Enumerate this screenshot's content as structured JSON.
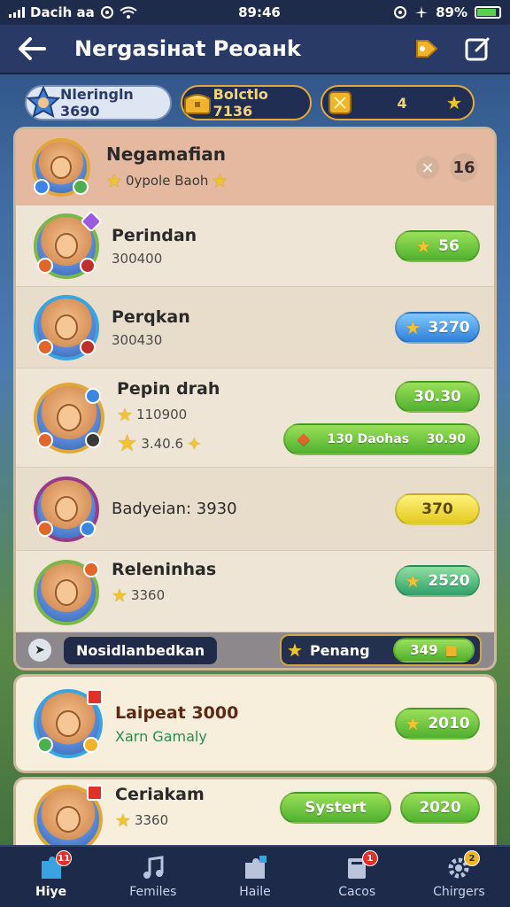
{
  "status_bar": {
    "carrier": "Dacih aa",
    "time": "89:46",
    "battery": "89%"
  },
  "header": {
    "title": "Nergasiнat Peoaнk"
  },
  "currency": [
    {
      "label": "Nleringln 3690"
    },
    {
      "label": "Bolctlo 7136"
    },
    {
      "label": "4"
    }
  ],
  "panel_head": {
    "name": "Negamafian",
    "sub": "0ypole Baoh",
    "count": "16"
  },
  "rows": [
    {
      "name": "Perindan",
      "value": "300400",
      "button": "56"
    },
    {
      "name": "Perqkan",
      "value": "300430",
      "button": "3270"
    },
    {
      "name": "Pepin drah",
      "value": "110900",
      "value2": "3.40.6",
      "button": "30.30",
      "sub_button": "130 Daohas",
      "sub_value": "30.90"
    },
    {
      "name": "Badyeian: 3930",
      "button": "370"
    },
    {
      "name": "Releninhas",
      "value": "3360",
      "button": "2520"
    }
  ],
  "tooltip": {
    "label": "Nosidlanbedkan",
    "pill_label": "Penang",
    "pill_value": "349"
  },
  "card1": {
    "name": "Laipeat 3000",
    "sub": "Xarn Gamaly",
    "button": "2010"
  },
  "card2": {
    "name": "Ceriakam",
    "value": "3360",
    "button_a": "Systert",
    "button_b": "2020"
  },
  "nav": [
    {
      "label": "Hiye",
      "badge": "11"
    },
    {
      "label": "Femiles"
    },
    {
      "label": "Haile"
    },
    {
      "label": "Cacos",
      "badge": "1"
    },
    {
      "label": "Chirgers",
      "badge": "2"
    }
  ],
  "colors": {
    "accent_green": "#4fb02e",
    "accent_blue": "#2e7fd8",
    "header_bg": "#2a3a66",
    "panel_bg": "#efe5d6"
  }
}
